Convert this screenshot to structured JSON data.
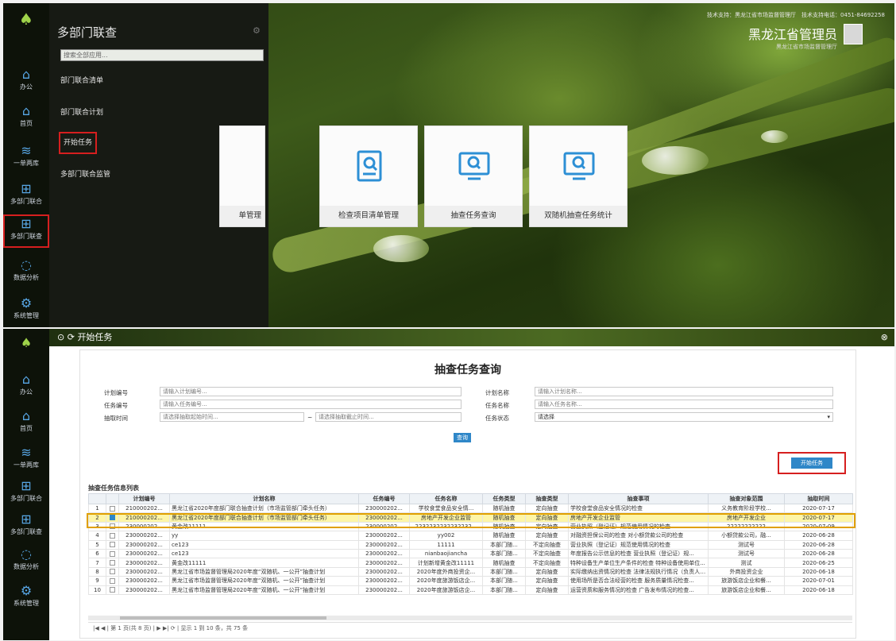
{
  "top": {
    "logo": "tree-logo",
    "iconbar": [
      {
        "label": "办公",
        "icon": "home-icon"
      },
      {
        "label": "首页",
        "icon": "home-icon"
      },
      {
        "label": "一单两库",
        "icon": "layers-icon"
      },
      {
        "label": "多部门联合",
        "icon": "windows-icon"
      },
      {
        "label": "多部门联查",
        "icon": "windows-icon"
      },
      {
        "label": "数据分析",
        "icon": "loading-icon"
      },
      {
        "label": "系统管理",
        "icon": "gear-icon"
      }
    ],
    "panel": {
      "title": "多部门联查",
      "search_placeholder": "搜索全部应用...",
      "menu": [
        "部门联合清单",
        "部门联合计划",
        "开始任务",
        "多部门联合监管"
      ]
    },
    "tiles": [
      {
        "label": "单管理",
        "icon": "list-icon"
      },
      {
        "label": "检查项目清单管理",
        "icon": "document-search-icon"
      },
      {
        "label": "抽查任务查询",
        "icon": "monitor-search-icon"
      },
      {
        "label": "双随机抽查任务统计",
        "icon": "monitor-search-icon"
      }
    ],
    "header": {
      "tech": "技术支持：黑龙江省市场监督管理厅　技术支持电话：0451-84692258",
      "user": "黑龙江省管理员",
      "org": "黑龙江省市场监督管理厅"
    }
  },
  "bottom": {
    "iconbar": [
      {
        "label": "办公",
        "icon": "home-icon"
      },
      {
        "label": "首页",
        "icon": "home-icon"
      },
      {
        "label": "一单两库",
        "icon": "layers-icon"
      },
      {
        "label": "多部门联合",
        "icon": "windows-icon"
      },
      {
        "label": "多部门联查",
        "icon": "windows-icon"
      },
      {
        "label": "数据分析",
        "icon": "loading-icon"
      },
      {
        "label": "系统管理",
        "icon": "gear-icon"
      }
    ],
    "titlebar": {
      "title": "开始任务"
    },
    "form": {
      "title": "抽查任务查询",
      "labels": {
        "plan_no": "计划编号",
        "task_no": "任务编号",
        "time": "抽取时间",
        "plan_name": "计划名称",
        "task_name": "任务名称",
        "task_status": "任务状态"
      },
      "placeholders": {
        "plan_no": "请输入计划编号...",
        "task_no": "请输入任务编号...",
        "time_start": "请选择抽取起始时间...",
        "time_end": "请选择抽取截止时间...",
        "plan_name": "请输入计划名称...",
        "task_name": "请输入任务名称..."
      },
      "range_sep": "~",
      "status_value": "请选择",
      "query_label": "查询",
      "start_label": "开始任务"
    },
    "list": {
      "title": "抽查任务信息列表",
      "columns": [
        "",
        "",
        "计划编号",
        "计划名称",
        "任务编号",
        "任务名称",
        "任务类型",
        "抽查类型",
        "抽查事项",
        "抽查对象范围",
        "抽取时间"
      ],
      "rows": [
        [
          "1",
          false,
          "210000202...",
          "黑龙江省2020年度部门联合抽查计划（市场监管部门牵头任务）",
          "230000202...",
          "学校食堂食品安全情...",
          "随机抽查",
          "定向抽查",
          "学校食堂食品安全情况的检查",
          "义务教育阶段学校...",
          "2020-07-17"
        ],
        [
          "2",
          true,
          "210000202...",
          "黑龙江省2020年度部门联合抽查计划（市场监管部门牵头任务）",
          "230000202...",
          "房地产开发企业监管",
          "随机抽查",
          "定向抽查",
          "房地产开发企业监管",
          "房地产开发企业",
          "2020-07-17"
        ],
        [
          "3",
          false,
          "230000202...",
          "黄金改11111",
          "230000202...",
          "2232232232232232...",
          "随机抽查",
          "定向抽查",
          "营业执照（登记证）规范使用情况的检查",
          "22222222222",
          "2020-07-09"
        ],
        [
          "4",
          false,
          "230000202...",
          "yy",
          "230000202...",
          "yy002",
          "随机抽查",
          "定向抽查",
          "对融资担保公司的检查 对小额贷款公司的检查",
          "小额贷款公司，融...",
          "2020-06-28"
        ],
        [
          "5",
          false,
          "230000202...",
          "ce123",
          "230000202...",
          "11111",
          "本部门随...",
          "不定向抽查",
          "营业执照（登记证）规范使用情况的检查",
          "测试号",
          "2020-06-28"
        ],
        [
          "6",
          false,
          "230000202...",
          "ce123",
          "230000202...",
          "nianbaojiancha",
          "本部门随...",
          "不定向抽查",
          "年度报告公示信息的检查 营业执照（登记证）规...",
          "测试号",
          "2020-06-28"
        ],
        [
          "7",
          false,
          "230000202...",
          "黄金改11111",
          "230000202...",
          "计划新增黄金改11111",
          "随机抽查",
          "不定向抽查",
          "特种设备生产单位生产条件的检查 特种设备使用单位...",
          "测试",
          "2020-06-25"
        ],
        [
          "8",
          false,
          "230000202...",
          "黑龙江省市场监督管理局2020年度“双随机、一公开”抽查计划",
          "230000202...",
          "2020年度外商投资企...",
          "本部门随...",
          "定向抽查",
          "实际缴纳出资情况的检查 法律法规执行情况（负责人）...",
          "外商投资企业",
          "2020-06-18"
        ],
        [
          "9",
          false,
          "230000202...",
          "黑龙江省市场监督管理局2020年度“双随机、一公开”抽查计划",
          "230000202...",
          "2020年度旅游饭店企...",
          "本部门随...",
          "定向抽查",
          "使用场所是否合法经营的检查 服务质量情况检查...",
          "旅游饭店企业和餐...",
          "2020-07-01"
        ],
        [
          "10",
          false,
          "230000202...",
          "黑龙江省市场监督管理局2020年度“双随机、一公开”抽查计划",
          "230000202...",
          "2020年度旅游饭店企...",
          "本部门随...",
          "定向抽查",
          "运营资质和服务情况的检查 广告发布情况的检查...",
          "旅游饭店企业和餐...",
          "2020-06-18"
        ]
      ]
    },
    "pager": {
      "text": "|◀ ◀ | 第 1 页(共 8 页) | ▶ ▶| ⟳ | 显示 1 到 10 条，共 75 条"
    }
  }
}
